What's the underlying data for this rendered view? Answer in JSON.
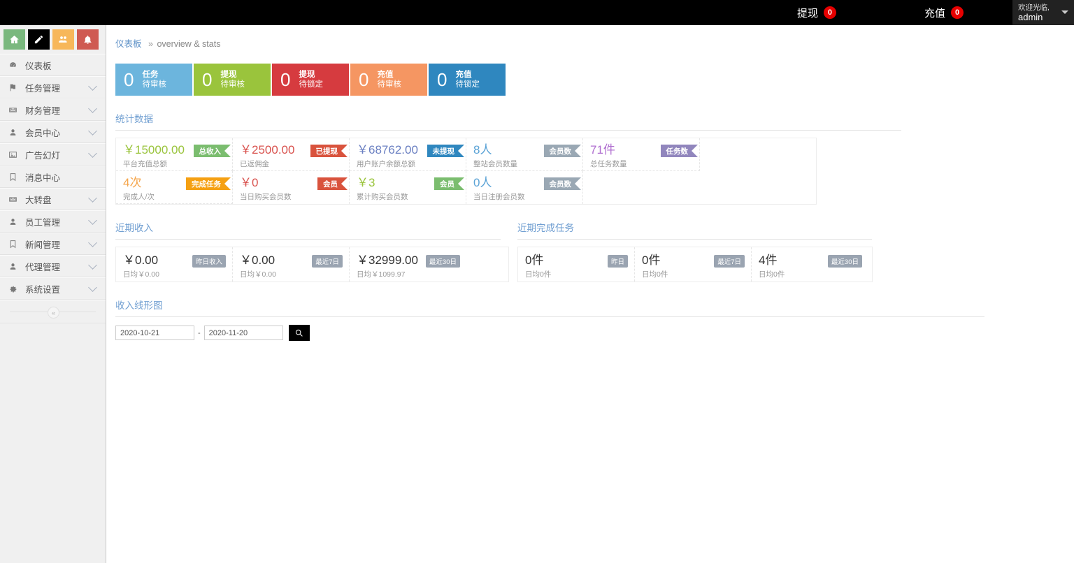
{
  "topbar": {
    "items": [
      {
        "label": "提现",
        "badge": "0",
        "name": "topnav-withdraw"
      },
      {
        "label": "充值",
        "badge": "0",
        "name": "topnav-recharge"
      }
    ],
    "user": {
      "greeting": "欢迎光临,",
      "name": "admin"
    }
  },
  "sidebar": {
    "quick_buttons": [
      {
        "icon": "home-icon",
        "color": "#7ab77a"
      },
      {
        "icon": "pencil-icon",
        "color": "#000000"
      },
      {
        "icon": "users-icon",
        "color": "#f5b košar"
      },
      {
        "icon": "bell-icon",
        "color": "#cf5a52"
      }
    ],
    "quick_colors": [
      "#7ab87e",
      "#000000",
      "#f7b75a",
      "#cf5a52"
    ],
    "items": [
      {
        "label": "仪表板",
        "icon": "dashboard-icon",
        "chevron": false
      },
      {
        "label": "任务管理",
        "icon": "flag-icon",
        "chevron": true
      },
      {
        "label": "财务管理",
        "icon": "inbox-icon",
        "chevron": true
      },
      {
        "label": "会员中心",
        "icon": "user-icon",
        "chevron": true
      },
      {
        "label": "广告幻灯",
        "icon": "image-icon",
        "chevron": true
      },
      {
        "label": "消息中心",
        "icon": "bookmark-icon",
        "chevron": false
      },
      {
        "label": "大转盘",
        "icon": "inbox-icon",
        "chevron": true
      },
      {
        "label": "员工管理",
        "icon": "user-icon",
        "chevron": true
      },
      {
        "label": "新闻管理",
        "icon": "bookmark-icon",
        "chevron": true
      },
      {
        "label": "代理管理",
        "icon": "user-icon",
        "chevron": true
      },
      {
        "label": "系统设置",
        "icon": "gear-icon",
        "chevron": true
      }
    ],
    "collapse_label": "«"
  },
  "breadcrumb": {
    "root": "仪表板",
    "sep": "»",
    "current": "overview & stats"
  },
  "top_cards": [
    {
      "num": "0",
      "line1": "任务",
      "line2": "待审核",
      "color": "#6cb5dd"
    },
    {
      "num": "0",
      "line1": "提现",
      "line2": "待审核",
      "color": "#9ac43c"
    },
    {
      "num": "0",
      "line1": "提现",
      "line2": "待锁定",
      "color": "#d63b3f"
    },
    {
      "num": "0",
      "line1": "充值",
      "line2": "待审核",
      "color": "#f59662"
    },
    {
      "num": "0",
      "line1": "充值",
      "line2": "待锁定",
      "color": "#2f87bf"
    }
  ],
  "stats_section": {
    "title": "统计数据",
    "cells": [
      {
        "value": "￥15000.00",
        "value_color": "#9ac43c",
        "sub": "平台充值总额",
        "ribbon": "总收入",
        "ribbon_color": "#7bbd6f"
      },
      {
        "value": "￥2500.00",
        "value_color": "#d9534f",
        "sub": "已返佣金",
        "ribbon": "已提现",
        "ribbon_color": "#d9533d"
      },
      {
        "value": "￥68762.00",
        "value_color": "#6b80c2",
        "sub": "用户账户余额总额",
        "ribbon": "未提现",
        "ribbon_color": "#2f87bf"
      },
      {
        "value": "8人",
        "value_color": "#5ba3d6",
        "sub": "整站会员数量",
        "ribbon": "会员数",
        "ribbon_color": "#9aa8b4"
      },
      {
        "value": "71件",
        "value_color": "#b06fd0",
        "sub": "总任务数量",
        "ribbon": "任务数",
        "ribbon_color": "#9186bd"
      },
      {
        "value": "4次",
        "value_color": "#f5a54a",
        "sub": "完成人/次",
        "ribbon": "完成任务",
        "ribbon_color": "#f5a012"
      },
      {
        "value": "￥0",
        "value_color": "#d9534f",
        "sub": "当日购买会员数",
        "ribbon": "会员",
        "ribbon_color": "#d9533d"
      },
      {
        "value": "￥3",
        "value_color": "#9ac43c",
        "sub": "累计购买会员数",
        "ribbon": "会员",
        "ribbon_color": "#7bbd6f"
      },
      {
        "value": "0人",
        "value_color": "#5ba3d6",
        "sub": "当日注册会员数",
        "ribbon": "会员数",
        "ribbon_color": "#9aa8b4"
      }
    ]
  },
  "recent_income": {
    "title": "近期收入",
    "cells": [
      {
        "value": "￥0.00",
        "sub": "日均￥0.00",
        "tag": "昨日收入"
      },
      {
        "value": "￥0.00",
        "sub": "日均￥0.00",
        "tag": "最近7日"
      },
      {
        "value": "￥32999.00",
        "sub": "日均￥1099.97",
        "tag": "最近30日"
      }
    ]
  },
  "recent_tasks": {
    "title": "近期完成任务",
    "cells": [
      {
        "value": "0件",
        "sub": "日均0件",
        "tag": "昨日"
      },
      {
        "value": "0件",
        "sub": "日均0件",
        "tag": "最近7日"
      },
      {
        "value": "4件",
        "sub": "日均0件",
        "tag": "最近30日"
      }
    ]
  },
  "chart_section": {
    "title": "收入线形图",
    "date_start": "2020-10-21",
    "date_end": "2020-11-20",
    "dash": "-",
    "search_icon": "search-icon"
  }
}
